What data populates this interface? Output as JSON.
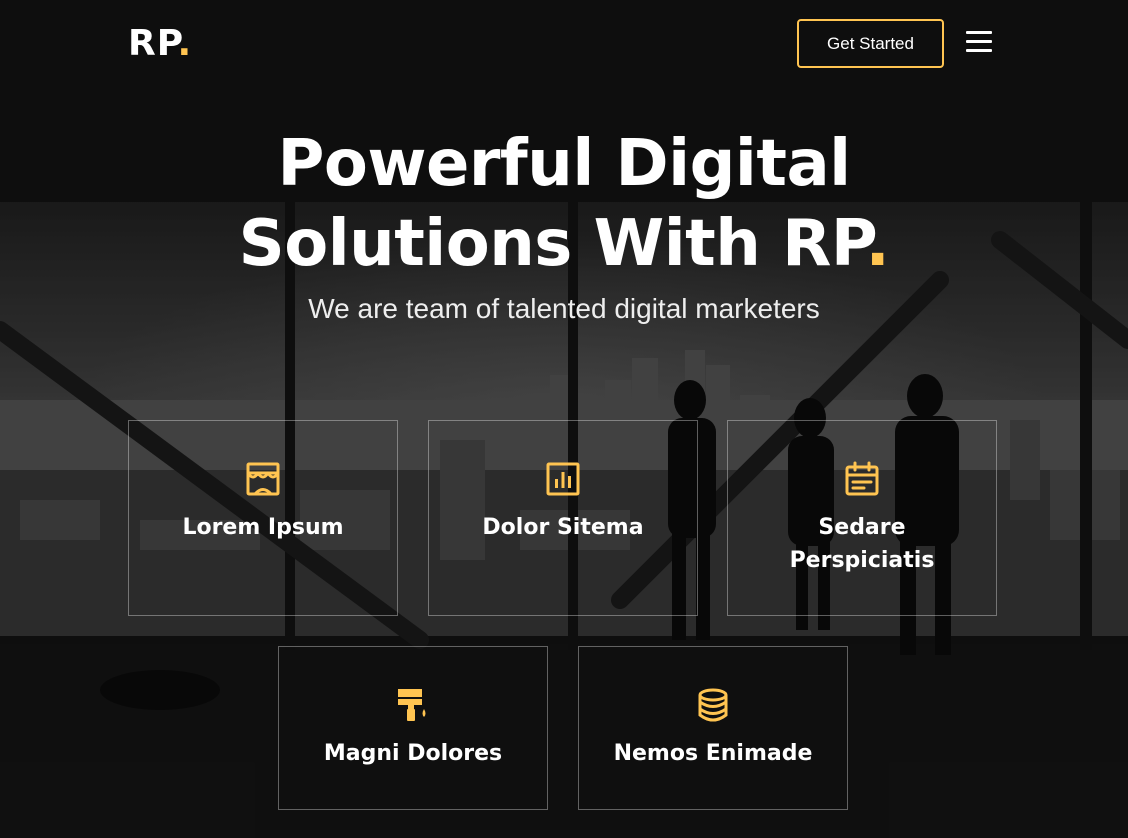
{
  "brand": {
    "logo_text": "RP",
    "logo_dot": ".",
    "accent_color": "#ffc451"
  },
  "header": {
    "cta_label": "Get Started",
    "menu_icon": "hamburger-menu-icon"
  },
  "hero": {
    "headline_line1": "Powerful Digital",
    "headline_line2": "Solutions With RP",
    "headline_dot": ".",
    "subheadline": "We are team of talented digital marketers",
    "background": "grayscale office skyline photo"
  },
  "features": [
    {
      "title": "Lorem Ipsum",
      "icon": "store-icon"
    },
    {
      "title": "Dolor Sitema",
      "icon": "bar-chart-icon"
    },
    {
      "title": "Sedare Perspiciatis",
      "icon": "calendar-icon"
    },
    {
      "title": "Magni Dolores",
      "icon": "paint-roller-icon"
    },
    {
      "title": "Nemos Enimade",
      "icon": "database-icon"
    }
  ]
}
